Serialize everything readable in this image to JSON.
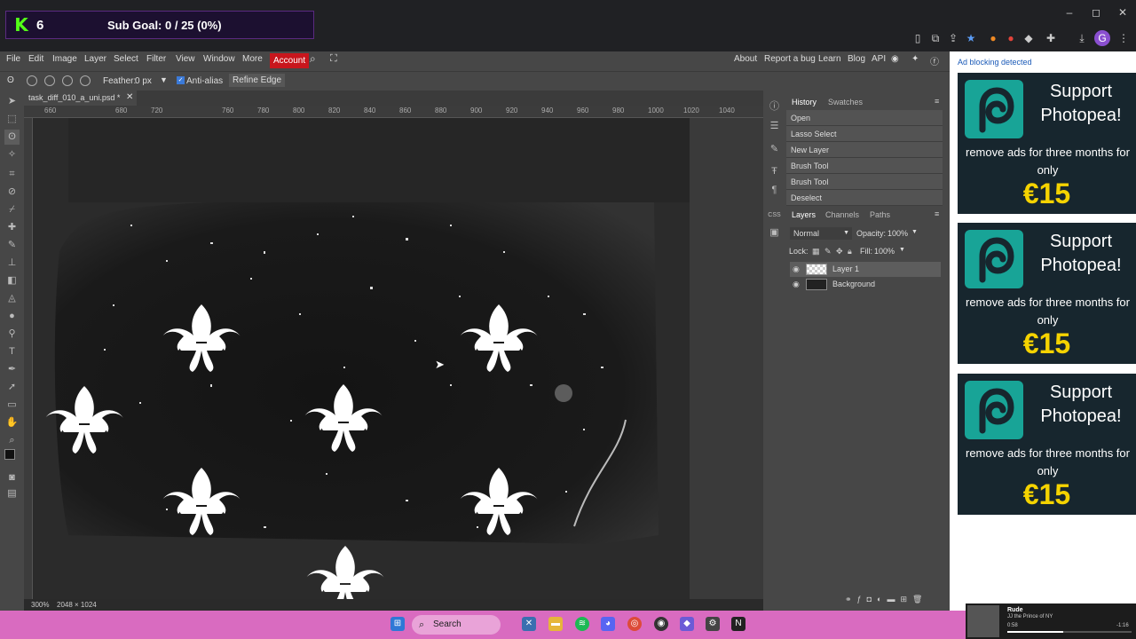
{
  "browser": {
    "controls": {
      "minimize": "–",
      "maximize": "◻",
      "close": "✕"
    }
  },
  "stream_overlay": {
    "kick_logo": "K",
    "count": "6",
    "sub_goal": "Sub Goal: 0 / 25 (0%)"
  },
  "menu": {
    "items": [
      "File",
      "Edit",
      "Image",
      "Layer",
      "Select",
      "Filter",
      "View",
      "Window",
      "More"
    ],
    "account": "Account",
    "right_links": [
      "About",
      "Report a bug",
      "Learn",
      "Blog",
      "API"
    ]
  },
  "options": {
    "feather_label": "Feather:",
    "feather_value": "0 px",
    "anti_alias_label": "Anti-alias",
    "refine_edge": "Refine Edge"
  },
  "document": {
    "tab_title": "task_diff_010_a_uni.psd *",
    "ruler_ticks": [
      "660",
      "680",
      "720",
      "760",
      "780",
      "800",
      "820",
      "840",
      "860",
      "880",
      "900",
      "920",
      "940",
      "960",
      "980",
      "1000",
      "1020",
      "1040"
    ],
    "zoom": "300%",
    "dimensions": "2048 × 1024"
  },
  "history": {
    "tabs": [
      "History",
      "Swatches"
    ],
    "items": [
      "Open",
      "Lasso Select",
      "New Layer",
      "Brush Tool",
      "Brush Tool",
      "Deselect"
    ]
  },
  "layers": {
    "tabs": [
      "Layers",
      "Channels",
      "Paths"
    ],
    "blend_mode": "Normal",
    "opacity_label": "Opacity:",
    "opacity_value": "100%",
    "lock_label": "Lock:",
    "fill_label": "Fill:",
    "fill_value": "100%",
    "items": [
      "Layer 1",
      "Background"
    ]
  },
  "ads": {
    "label": "Ad blocking detected",
    "cards": [
      {
        "title": "Support Photopea!",
        "body": "remove ads for three months for only",
        "price": "€15"
      },
      {
        "title": "Support Photopea!",
        "body": "remove ads for three months for only",
        "price": "€15"
      },
      {
        "title": "Support Photopea!",
        "body": "remove ads for three months for only",
        "price": "€15"
      }
    ]
  },
  "taskbar": {
    "search": "Search",
    "media": {
      "title": "Rude",
      "artist": "JJ the Prince of NY",
      "elapsed": "0:58",
      "remaining": "-1:16"
    }
  }
}
